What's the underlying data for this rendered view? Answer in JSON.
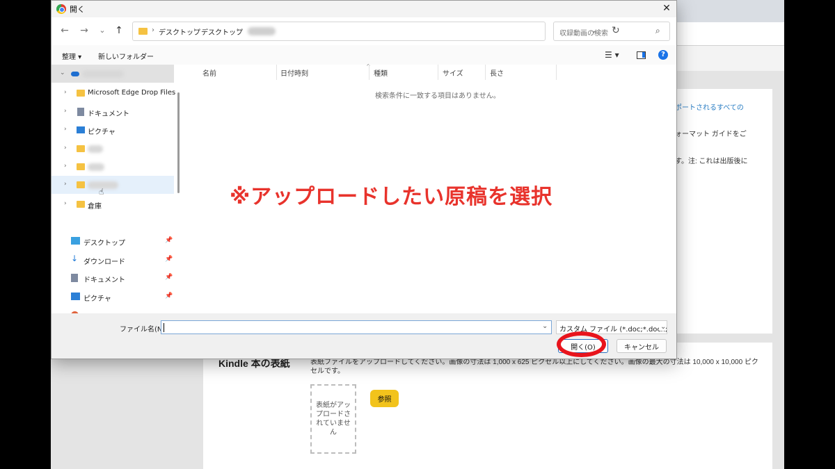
{
  "browser": {
    "star_icon": "star-icon",
    "page_texts": {
      "line1": "ポートされるすべての",
      "line2": "ォーマット ガイドをご",
      "line3": "す。注: これは出版後に"
    },
    "cover": {
      "title": "Kindle 本の表紙",
      "description": "表紙ファイルをアップロードしてください。画像の寸法は 1,000 x 625 ピクセル以上にしてください。画像の最大の寸法は 10,000 x 10,000 ピクセルです。",
      "placeholder": "表紙がアップロードされていません",
      "browse_label": "参照"
    }
  },
  "dialog": {
    "title": "開く",
    "close_glyph": "✕",
    "nav": {
      "back": "←",
      "forward": "→",
      "recent": "⌄",
      "up": "↑"
    },
    "breadcrumb": [
      "デスクトップ",
      "デスクトップ"
    ],
    "breadcrumb_sep": "›",
    "search_placeholder": "収録動画の検索",
    "commands": {
      "organize": "整理 ▾",
      "new_folder": "新しいフォルダー"
    },
    "tree": [
      {
        "label": "Microsoft Edge Drop Files"
      },
      {
        "label": "ドキュメント"
      },
      {
        "label": "ピクチャ"
      },
      {
        "label": "倉庫"
      }
    ],
    "quick_access": [
      {
        "label": "デスクトップ"
      },
      {
        "label": "ダウンロード"
      },
      {
        "label": "ドキュメント"
      },
      {
        "label": "ピクチャ"
      }
    ],
    "columns": [
      "名前",
      "日付時刻",
      "種類",
      "サイズ",
      "長さ"
    ],
    "empty_message": "検索条件に一致する項目はありません。",
    "filename_label": "ファイル名(N):",
    "filename_value": "",
    "file_type_filter": "カスタム ファイル (*.doc;*.docx;*.zip",
    "open_button": "開く(O)",
    "cancel_button": "キャンセル"
  },
  "annotation": {
    "note": "※アップロードしたい原稿を選択",
    "color": "#e8332c"
  }
}
